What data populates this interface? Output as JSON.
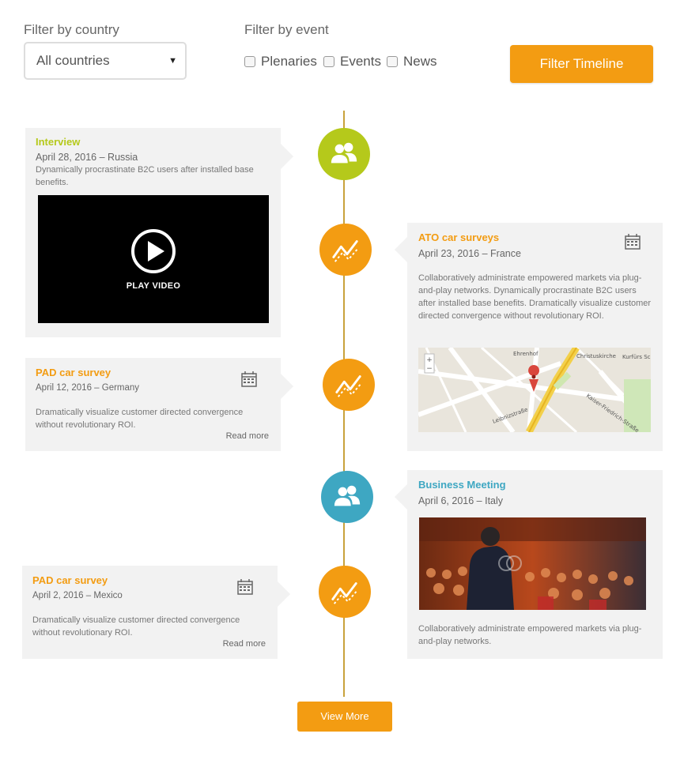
{
  "filters": {
    "country_label": "Filter by country",
    "country_value": "All countries",
    "event_label": "Filter by event",
    "options": [
      "Plenaries",
      "Events",
      "News"
    ],
    "button_label": "Filter Timeline"
  },
  "colors": {
    "orange": "#f39c12",
    "green": "#b5c91b",
    "teal": "#3ea7c2",
    "timeline_line": "#c8a23c",
    "card_bg": "#f2f2f2"
  },
  "items": [
    {
      "title": "Interview",
      "date": "April 28, 2016",
      "country": "– Russia",
      "body": "Dynamically procrastinate B2C users after installed base benefits.",
      "media": "video",
      "media_label": "PLAY VIDEO",
      "icon": "people-icon"
    },
    {
      "title": "ATO car surveys",
      "date": "April 23, 2016",
      "country": "– France",
      "body": "Collaboratively administrate empowered markets via plug-and-play networks. Dynamically procrastinate B2C users after installed base benefits. Dramatically visualize customer directed convergence without revolutionary ROI.",
      "media": "map",
      "map_labels": [
        "Ehrenhof",
        "Christuskirche",
        "Kurfürs Schloss",
        "Leibnizstraße",
        "Kaiser-Friedrich-Straße"
      ],
      "icon": "trend-icon"
    },
    {
      "title": "PAD car survey",
      "date": "April 12, 2016",
      "country": "– Germany",
      "body": "Dramatically visualize customer directed convergence without revolutionary ROI.",
      "read_more": "Read more",
      "icon": "trend-icon"
    },
    {
      "title": "Business Meeting",
      "date": "April 6, 2016",
      "country": "– Italy",
      "body": "Collaboratively administrate empowered markets via plug-and-play networks.",
      "media": "photo",
      "icon": "people-icon"
    },
    {
      "title": "PAD car survey",
      "date": "April 2, 2016",
      "country": "– Mexico",
      "body": "Dramatically visualize customer directed convergence without revolutionary ROI.",
      "read_more": "Read more",
      "icon": "trend-icon"
    }
  ],
  "view_more_label": "View More"
}
